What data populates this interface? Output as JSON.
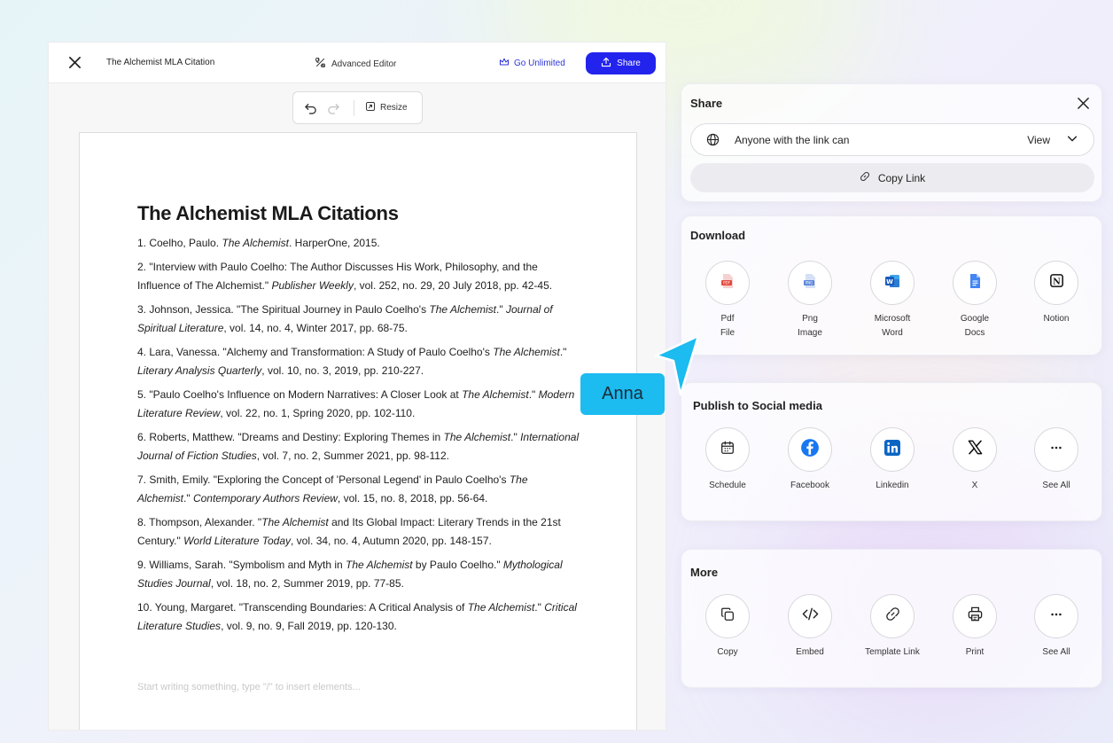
{
  "editor": {
    "doc_name": "The Alchemist MLA Citation",
    "advanced_editor": "Advanced Editor",
    "go_unlimited": "Go Unlimited",
    "share_label": "Share",
    "resize_label": "Resize",
    "title": "The Alchemist MLA Citations",
    "placeholder": "Start writing something, type \"/\" to insert elements...",
    "citations": [
      [
        "1. Coelho, Paulo. ",
        "The Alchemist",
        ". HarperOne, 2015.",
        "",
        ""
      ],
      [
        "2. \"Interview with Paulo Coelho: The Author Discusses His Work, Philosophy, and the Influence of The Alchemist.\" ",
        "Publisher Weekly",
        ", vol. 252, no. 29, 20 July 2018, pp. 42-45.",
        "",
        ""
      ],
      [
        "3. Johnson, Jessica. \"The Spiritual Journey in Paulo Coelho's ",
        "The Alchemist",
        ".\" ",
        "Journal of Spiritual Literature",
        ", vol. 14, no. 4, Winter 2017, pp. 68-75."
      ],
      [
        "4. Lara, Vanessa. \"Alchemy and Transformation: A Study of Paulo Coelho's ",
        "The Alchemist",
        ".\" ",
        "Literary Analysis Quarterly",
        ", vol. 10, no. 3, 2019, pp. 210-227."
      ],
      [
        "5. \"Paulo Coelho's Influence on Modern Narratives: A Closer Look at ",
        "The Alchemist",
        ".\" ",
        "Modern Literature Review",
        ", vol. 22, no. 1, Spring 2020, pp. 102-110."
      ],
      [
        "6. Roberts, Matthew. \"Dreams and Destiny: Exploring Themes in ",
        "The Alchemist",
        ".\" ",
        "International Journal of Fiction Studies",
        ", vol. 7, no. 2, Summer 2021, pp. 98-112."
      ],
      [
        "7. Smith, Emily. \"Exploring the Concept of 'Personal Legend' in Paulo Coelho's ",
        "The Alchemist",
        ".\" ",
        "Contemporary Authors Review",
        ", vol. 15, no. 8, 2018, pp. 56-64."
      ],
      [
        "8. Thompson, Alexander. \"",
        "The Alchemist",
        " and Its Global Impact: Literary Trends in the 21st Century.\" ",
        "World Literature Today",
        ", vol. 34, no. 4, Autumn 2020, pp. 148-157."
      ],
      [
        "9. Williams, Sarah. \"Symbolism and Myth in ",
        "The Alchemist",
        " by Paulo Coelho.\" ",
        "Mythological Studies Journal",
        ", vol. 18, no. 2, Summer 2019, pp. 77-85."
      ],
      [
        "10. Young, Margaret. \"Transcending Boundaries: A Critical Analysis of ",
        "The Alchemist",
        ".\" ",
        "Critical Literature Studies",
        ", vol. 9, no. 9, Fall 2019, pp. 120-130."
      ]
    ]
  },
  "share": {
    "title": "Share",
    "access_text": "Anyone with the link can",
    "access_level": "View",
    "copy_link": "Copy Link"
  },
  "download": {
    "title": "Download",
    "items": [
      {
        "l1": "Pdf",
        "l2": "File",
        "icon": "pdf-icon"
      },
      {
        "l1": "Png",
        "l2": "Image",
        "icon": "png-icon"
      },
      {
        "l1": "Microsoft",
        "l2": "Word",
        "icon": "word-icon"
      },
      {
        "l1": "Google",
        "l2": "Docs",
        "icon": "google-docs-icon"
      },
      {
        "l1": "Notion",
        "l2": "",
        "icon": "notion-icon"
      }
    ]
  },
  "social": {
    "title": "Publish to Social media",
    "items": [
      {
        "label": "Schedule",
        "icon": "calendar-icon"
      },
      {
        "label": "Facebook",
        "icon": "facebook-icon"
      },
      {
        "label": "Linkedin",
        "icon": "linkedin-icon"
      },
      {
        "label": "X",
        "icon": "x-icon"
      },
      {
        "label": "See All",
        "icon": "more-dots-icon"
      }
    ]
  },
  "more": {
    "title": "More",
    "items": [
      {
        "label": "Copy",
        "icon": "copy-icon"
      },
      {
        "label": "Embed",
        "icon": "code-icon"
      },
      {
        "label": "Template Link",
        "icon": "link-icon"
      },
      {
        "label": "Print",
        "icon": "printer-icon"
      },
      {
        "label": "See All",
        "icon": "more-dots-icon"
      }
    ]
  },
  "collaborator": {
    "name": "Anna",
    "color": "#1cbbf0"
  },
  "colors": {
    "accent": "#2323ee",
    "facebook": "#1877f2",
    "linkedin": "#0a66c2",
    "word": "#185abd",
    "docs": "#4285f4",
    "pdf": "#e5483d"
  }
}
